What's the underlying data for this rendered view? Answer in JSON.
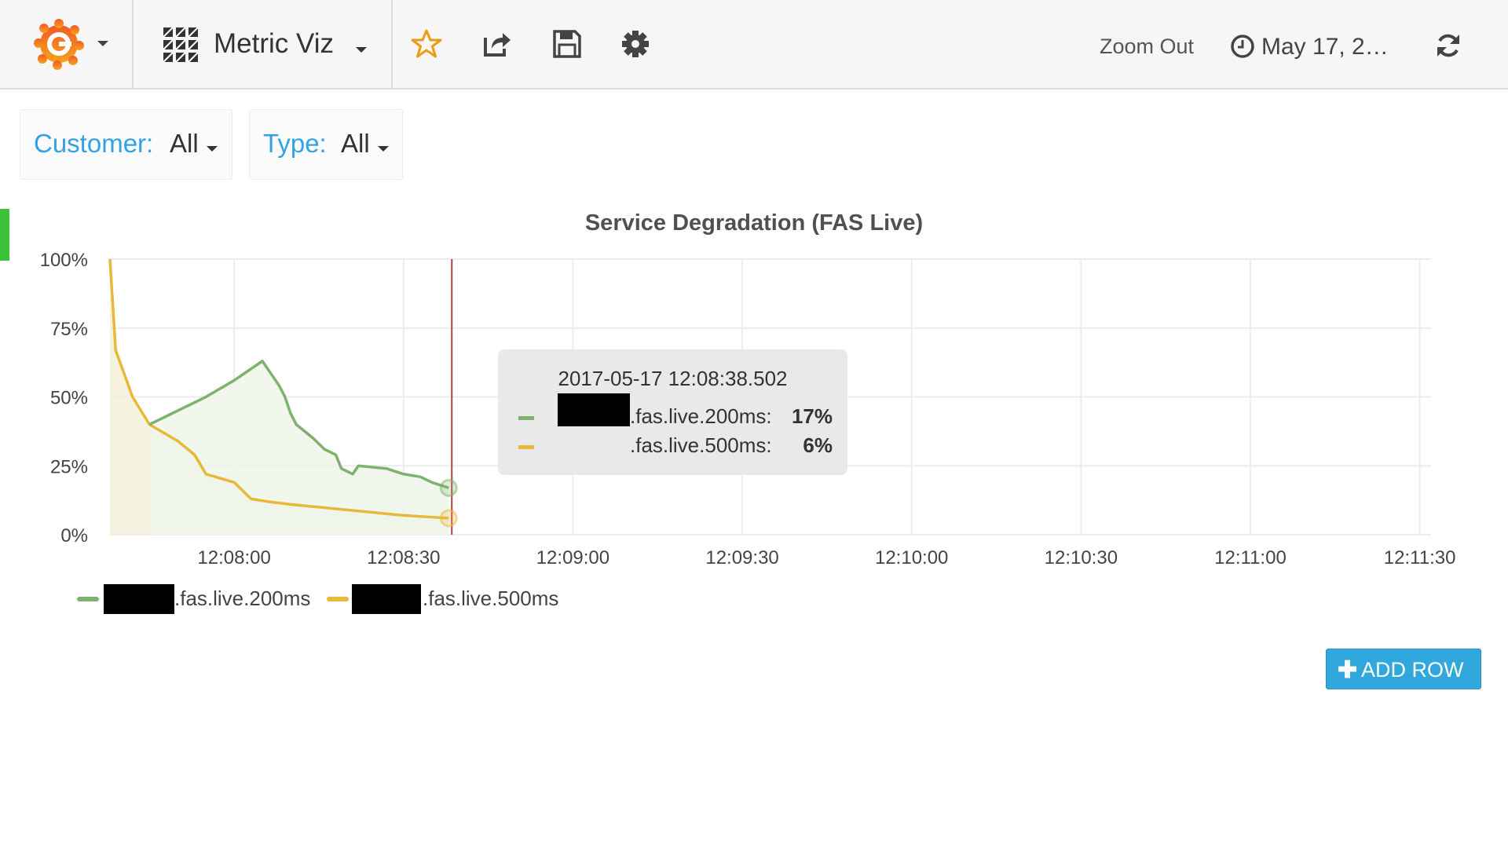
{
  "nav": {
    "dashboard_title": "Metric Viz",
    "zoom_out_label": "Zoom Out",
    "time_range": "May 17, 2…",
    "icons": [
      "grafana-logo-icon",
      "dashboard-grid-icon",
      "star-icon",
      "share-icon",
      "save-icon",
      "gear-icon",
      "clock-icon",
      "refresh-icon"
    ]
  },
  "variables": [
    {
      "label": "Customer:",
      "value": "All"
    },
    {
      "label": "Type:",
      "value": "All"
    }
  ],
  "panel": {
    "title": "Service Degradation (FAS Live)"
  },
  "tooltip": {
    "time": "2017-05-17 12:08:38.502",
    "rows": [
      {
        "name": ".fas.live.200ms:",
        "value": "17%",
        "color": "#7eb26d"
      },
      {
        "name": ".fas.live.500ms:",
        "value": "6%",
        "color": "#eab839"
      }
    ]
  },
  "legend": [
    {
      "name": ".fas.live.200ms",
      "color": "#7eb26d"
    },
    {
      "name": ".fas.live.500ms",
      "color": "#eab839"
    }
  ],
  "add_row_label": "ADD ROW",
  "colors": {
    "accent": "#33a2e5",
    "series_200ms": "#7eb26d",
    "series_500ms": "#eab839",
    "cursor_line": "#b04040",
    "add_row_bg": "#31a8dd"
  },
  "chart_data": {
    "type": "area",
    "title": "Service Degradation (FAS Live)",
    "y_unit": "%",
    "ylim": [
      0,
      100
    ],
    "y_ticks": [
      "0%",
      "25%",
      "50%",
      "75%",
      "100%"
    ],
    "x_ticks": [
      "12:08:00",
      "12:08:30",
      "12:09:00",
      "12:09:30",
      "12:10:00",
      "12:10:30",
      "12:11:00",
      "12:11:30"
    ],
    "xlim": [
      "12:07:38",
      "12:11:32"
    ],
    "cursor": "12:08:38.502",
    "grid": true,
    "legend_position": "bottom-left",
    "series": [
      {
        "name": ".fas.live.200ms",
        "x": [
          "12:07:45",
          "12:07:55",
          "12:08:00",
          "12:08:05",
          "12:08:07",
          "12:08:08",
          "12:08:09",
          "12:08:10",
          "12:08:11",
          "12:08:14",
          "12:08:16",
          "12:08:18",
          "12:08:19",
          "12:08:21",
          "12:08:22",
          "12:08:27",
          "12:08:30",
          "12:08:33",
          "12:08:35",
          "12:08:38"
        ],
        "values": [
          40,
          50,
          56,
          63,
          57,
          54,
          50,
          44,
          40,
          35,
          31,
          29,
          24,
          22,
          25,
          24,
          22,
          21,
          19,
          17
        ]
      },
      {
        "name": ".fas.live.500ms",
        "x": [
          "12:07:38",
          "12:07:39",
          "12:07:42",
          "12:07:45",
          "12:07:50",
          "12:07:53",
          "12:07:55",
          "12:08:00",
          "12:08:03",
          "12:08:06",
          "12:08:10",
          "12:08:15",
          "12:08:20",
          "12:08:25",
          "12:08:30",
          "12:08:38"
        ],
        "values": [
          100,
          67,
          50,
          40,
          34,
          29,
          22,
          19,
          13,
          12,
          11,
          10,
          9,
          8,
          7,
          6
        ]
      }
    ]
  }
}
